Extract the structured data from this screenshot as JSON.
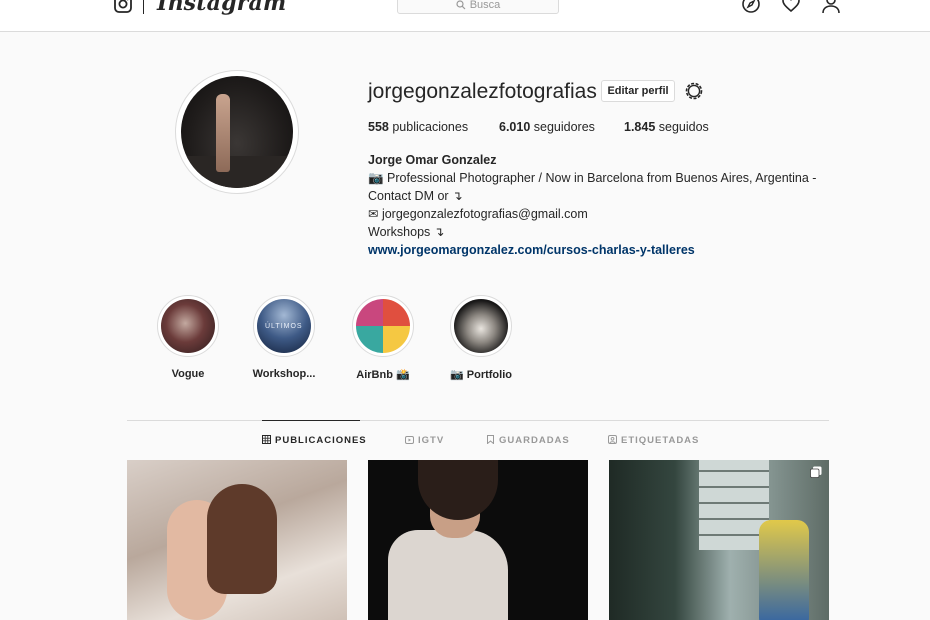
{
  "nav": {
    "brand": "Instagram",
    "search_placeholder": "Busca"
  },
  "profile": {
    "username": "jorgegonzalezfotografias",
    "edit_label": "Editar perfil",
    "stats": {
      "posts_count": "558",
      "posts_label": "publicaciones",
      "followers_count": "6.010",
      "followers_label": "seguidores",
      "following_count": "1.845",
      "following_label": "seguidos"
    },
    "bio": {
      "name": "Jorge Omar Gonzalez",
      "line1": "📷 Professional Photographer / Now in Barcelona from Buenos Aires, Argentina - Contact DM or ↴",
      "line2": "✉ jorgegonzalezfotografias@gmail.com",
      "line3": "Workshops ↴",
      "link": "www.jorgeomargonzalez.com/cursos-charlas-y-talleres"
    }
  },
  "highlights": [
    {
      "label": "Vogue"
    },
    {
      "label": "Workshop...",
      "image_text": "ÚLTIMOS"
    },
    {
      "label": "AirBnb 📸"
    },
    {
      "label": "📷 Portfolio"
    }
  ],
  "tabs": [
    {
      "label": "PUBLICACIONES",
      "active": true,
      "icon": "grid-icon"
    },
    {
      "label": "IGTV",
      "active": false,
      "icon": "igtv-icon"
    },
    {
      "label": "GUARDADAS",
      "active": false,
      "icon": "bookmark-icon"
    },
    {
      "label": "ETIQUETADAS",
      "active": false,
      "icon": "tag-icon"
    }
  ],
  "colors": {
    "background": "#fafafa",
    "text": "#262626",
    "link": "#003569",
    "border": "#dbdbdb",
    "muted": "#999999"
  }
}
